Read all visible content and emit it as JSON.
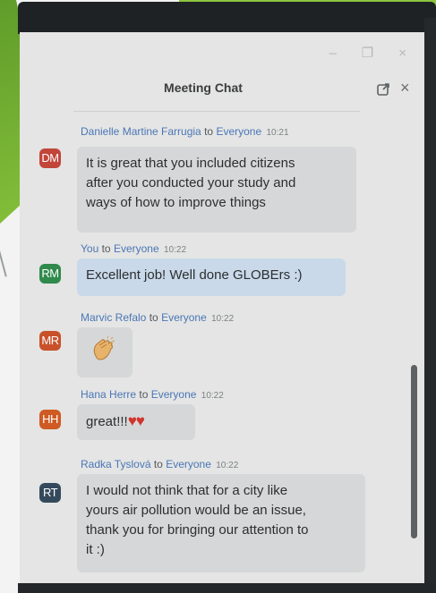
{
  "window": {
    "title": "Meeting Chat",
    "controls": {
      "minimize": "–",
      "restore": "❐",
      "close": "×"
    },
    "close_label": "×"
  },
  "messages": [
    {
      "sender": "Danielle Martine Farrugia",
      "to_word": "to",
      "recipient": "Everyone",
      "time": "10:21",
      "initials": "DM",
      "avatar_color": "#c2453a",
      "text": "It is great that you included citizens\nafter you conducted your study and\nways of how to improve things"
    },
    {
      "sender": "You",
      "to_word": "to",
      "recipient": "Everyone",
      "time": "10:22",
      "initials": "RM",
      "avatar_color": "#2f8a4c",
      "text": "Excellent job! Well done GLOBErs :)"
    },
    {
      "sender": "Marvic Refalo",
      "to_word": "to",
      "recipient": "Everyone",
      "time": "10:22",
      "initials": "MR",
      "avatar_color": "#c8512a",
      "text": ""
    },
    {
      "sender": "Hana Herre",
      "to_word": "to",
      "recipient": "Everyone",
      "time": "10:22",
      "initials": "HH",
      "avatar_color": "#cf5a23",
      "text": "great!!!",
      "emoji": "♥♥"
    },
    {
      "sender": "Radka Tyslová",
      "to_word": "to",
      "recipient": "Everyone",
      "time": "10:22",
      "initials": "RT",
      "avatar_color": "#344a5c",
      "text": "I would not think that for a city like\nyours air pollution would be an issue,\nthank you for bringing our attention to\nit :)"
    }
  ],
  "colors": {
    "sender_name": "#4b76b7",
    "bubble": "#d6d7d8",
    "own_bubble": "#c9d9ea",
    "accent_green": "#8cc53e"
  },
  "icons": [
    "popout-icon",
    "close-icon",
    "clap-emoji",
    "heart-emoji"
  ]
}
